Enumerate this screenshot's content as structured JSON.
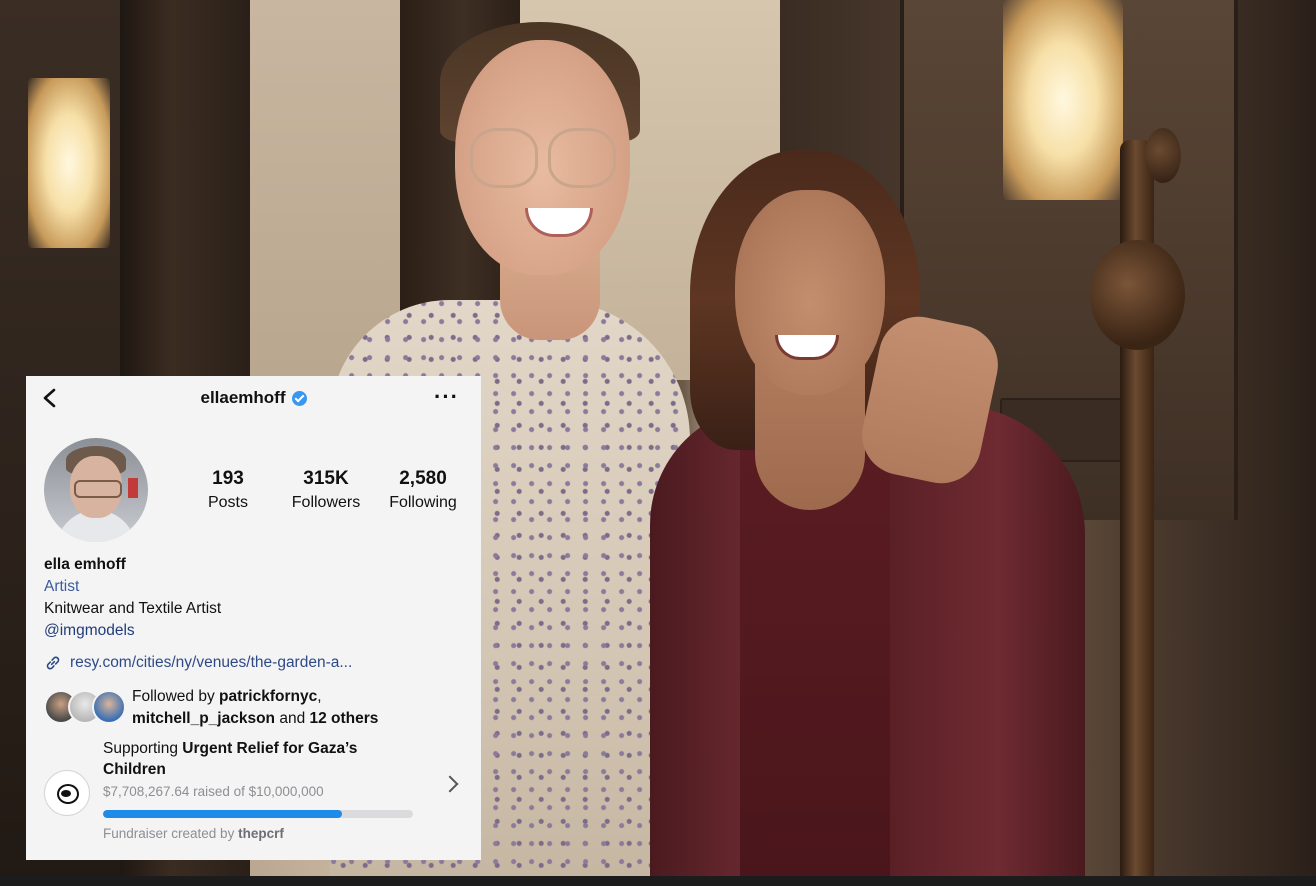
{
  "profile": {
    "username": "ellaemhoff",
    "verified": true,
    "more_label": "···"
  },
  "stats": {
    "posts": {
      "value": "193",
      "label": "Posts"
    },
    "followers": {
      "value": "315K",
      "label": "Followers"
    },
    "following": {
      "value": "2,580",
      "label": "Following"
    }
  },
  "bio": {
    "name": "ella emhoff",
    "category": "Artist",
    "description": "Knitwear and Textile Artist",
    "mention": "@imgmodels",
    "link": "resy.com/cities/ny/venues/the-garden-a..."
  },
  "followed_by": {
    "prefix": "Followed by ",
    "user1": "patrickfornyc",
    "comma": ",",
    "user2": "mitchell_p_jackson",
    "and": " and ",
    "others": "12 others"
  },
  "fundraiser": {
    "prefix": "Supporting ",
    "cause": "Urgent Relief for Gaza’s Children",
    "raised_text": "$7,708,267.64 raised of $10,000,000",
    "progress_fraction": 0.77,
    "created_prefix": "Fundraiser created by ",
    "creator": "thepcrf"
  },
  "colors": {
    "verified_badge": "#3897f0",
    "progress": "#1f8be9",
    "link": "#2e4a86",
    "category": "#3b5b9c"
  }
}
